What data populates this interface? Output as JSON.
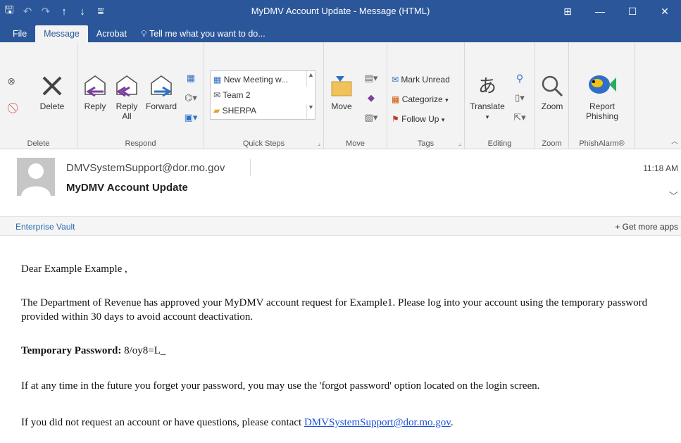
{
  "window": {
    "title": "MyDMV Account Update - Message (HTML)",
    "quick_icons": [
      "save-icon",
      "undo-icon",
      "redo-icon",
      "up-arrow-icon",
      "down-arrow-icon",
      "customize-icon"
    ],
    "controls": [
      "ribbon-display-icon",
      "minimize-icon",
      "maximize-icon",
      "close-icon"
    ]
  },
  "tabs": [
    {
      "label": "File"
    },
    {
      "label": "Message",
      "active": true
    },
    {
      "label": "Acrobat"
    }
  ],
  "tell_me": "Tell me what you want to do...",
  "ribbon": {
    "delete": {
      "group_label": "Delete",
      "delete_label": "Delete"
    },
    "respond": {
      "group_label": "Respond",
      "reply": "Reply",
      "reply_all_1": "Reply",
      "reply_all_2": "All",
      "forward": "Forward"
    },
    "quick_steps": {
      "group_label": "Quick Steps",
      "items": [
        "New Meeting w...",
        "Team 2",
        "SHERPA"
      ]
    },
    "move": {
      "group_label": "Move",
      "move_label": "Move"
    },
    "tags": {
      "group_label": "Tags",
      "mark_unread": "Mark Unread",
      "categorize": "Categorize",
      "follow_up": "Follow Up"
    },
    "editing": {
      "group_label": "Editing",
      "translate": "Translate"
    },
    "zoom": {
      "group_label": "Zoom",
      "zoom_label": "Zoom"
    },
    "phishalarm": {
      "group_label": "PhishAlarm®",
      "report_1": "Report",
      "report_2": "Phishing"
    }
  },
  "message": {
    "sender": "DMVSystemSupport@dor.mo.gov",
    "subject": "MyDMV Account Update",
    "time": "11:18 AM"
  },
  "addins": {
    "enterprise_vault": "Enterprise Vault",
    "get_more": "Get more apps"
  },
  "body": {
    "greeting": "Dear Example Example ,",
    "para1": "The Department of Revenue has approved your MyDMV account request for Example1. Please log into your account using the temporary password provided within 30 days to avoid account deactivation.",
    "temp_label": "Temporary Password:",
    "temp_value": "8/oy8=L_",
    "para3": "If at any time in the future you forget your password, you may use the 'forgot password' option located on the login screen.",
    "para4_prefix": "If you did not request an account or have questions, please contact",
    "para4_link": "DMVSystemSupport@dor.mo.gov",
    "para4_suffix": "."
  }
}
